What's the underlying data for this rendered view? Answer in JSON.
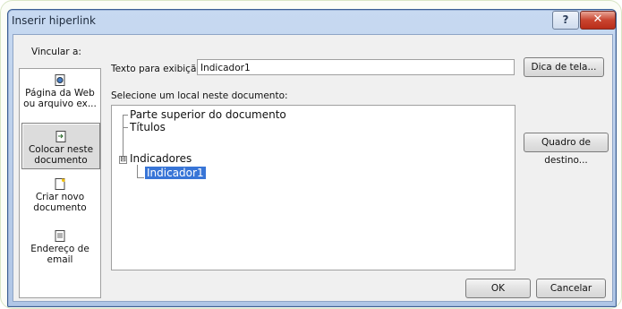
{
  "dialog": {
    "title": "Inserir hiperlink",
    "help_glyph": "?",
    "close_glyph": "✕"
  },
  "sidebar": {
    "label": "Vincular a:",
    "items": [
      {
        "line1": "Página da Web",
        "line2": "ou arquivo ex...",
        "icon": "web-page-icon",
        "selected": false
      },
      {
        "line1": "Colocar neste",
        "line2": "documento",
        "icon": "place-in-document-icon",
        "selected": true
      },
      {
        "line1": "Criar novo",
        "line2": "documento",
        "icon": "new-document-icon",
        "selected": false
      },
      {
        "line1": "Endereço de",
        "line2": "email",
        "icon": "email-address-icon",
        "selected": false
      }
    ]
  },
  "texto": {
    "label": "Texto para exibição:",
    "value": "Indicador1"
  },
  "buttons": {
    "dica": "Dica de tela...",
    "quadro": "Quadro de destino...",
    "ok": "OK",
    "cancelar": "Cancelar"
  },
  "tree": {
    "label": "Selecione um local neste documento:",
    "nodes": [
      {
        "label": "Parte superior do documento"
      },
      {
        "label": "Títulos"
      },
      {
        "label": "Indicadores",
        "expander": "⊟"
      },
      {
        "label": "Indicador1",
        "selected": true
      }
    ]
  },
  "colors": {
    "selection": "#3875d7",
    "title_bar": "#b9cde9",
    "close_button": "#c9442f"
  }
}
